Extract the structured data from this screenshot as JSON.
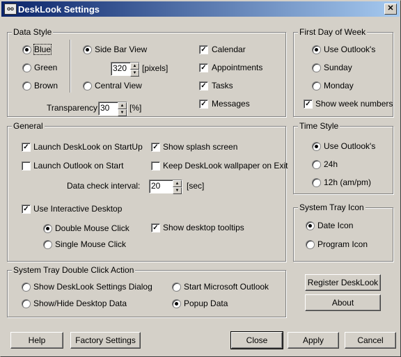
{
  "window": {
    "title": "DeskLook Settings",
    "icon_text": "oo",
    "close_glyph": "✕"
  },
  "data_style": {
    "legend": "Data Style",
    "colors": [
      {
        "label": "Blue",
        "checked": true
      },
      {
        "label": "Green",
        "checked": false
      },
      {
        "label": "Brown",
        "checked": false
      }
    ],
    "views": [
      {
        "label": "Side Bar View",
        "checked": true
      },
      {
        "label": "Central View",
        "checked": false
      }
    ],
    "sidebar_width": {
      "value": "320",
      "unit": "[pixels]"
    },
    "items": [
      {
        "label": "Calendar",
        "checked": true
      },
      {
        "label": "Appointments",
        "checked": true
      },
      {
        "label": "Tasks",
        "checked": true
      },
      {
        "label": "Messages",
        "checked": true
      }
    ],
    "transparency": {
      "label": "Transparency:",
      "value": "30",
      "unit": "[%]"
    }
  },
  "first_day": {
    "legend": "First Day of Week",
    "options": [
      {
        "label": "Use Outlook's",
        "checked": true
      },
      {
        "label": "Sunday",
        "checked": false
      },
      {
        "label": "Monday",
        "checked": false
      }
    ],
    "week_numbers": {
      "label": "Show week numbers",
      "checked": true
    }
  },
  "general": {
    "legend": "General",
    "launch_startup": {
      "label": "Launch DeskLook on StartUp",
      "checked": true
    },
    "launch_outlook": {
      "label": "Launch Outlook on Start",
      "checked": false
    },
    "splash": {
      "label": "Show splash screen",
      "checked": true
    },
    "keep_wallpaper": {
      "label": "Keep DeskLook wallpaper on Exit",
      "checked": false
    },
    "interval": {
      "label": "Data check interval:",
      "value": "20",
      "unit": "[sec]"
    },
    "interactive": {
      "label": "Use Interactive Desktop",
      "checked": true
    },
    "double_click": {
      "label": "Double Mouse Click",
      "checked": true
    },
    "single_click": {
      "label": "Single Mouse Click",
      "checked": false
    },
    "tooltips": {
      "label": "Show desktop tooltips",
      "checked": true
    }
  },
  "time_style": {
    "legend": "Time Style",
    "options": [
      {
        "label": "Use Outlook's",
        "checked": true
      },
      {
        "label": "24h",
        "checked": false
      },
      {
        "label": "12h (am/pm)",
        "checked": false
      }
    ]
  },
  "tray_icon": {
    "legend": "System Tray Icon",
    "options": [
      {
        "label": "Date Icon",
        "checked": true
      },
      {
        "label": "Program Icon",
        "checked": false
      }
    ]
  },
  "tray_action": {
    "legend": "System Tray Double Click Action",
    "options": [
      {
        "label": "Show DeskLook Settings Dialog",
        "checked": false
      },
      {
        "label": "Start Microsoft Outlook",
        "checked": false
      },
      {
        "label": "Show/Hide Desktop Data",
        "checked": false
      },
      {
        "label": "Popup Data",
        "checked": true
      }
    ]
  },
  "buttons": {
    "register": "Register DeskLook",
    "about": "About",
    "help": "Help",
    "factory": "Factory Settings",
    "close": "Close",
    "apply": "Apply",
    "cancel": "Cancel"
  },
  "check_glyph": "✓"
}
